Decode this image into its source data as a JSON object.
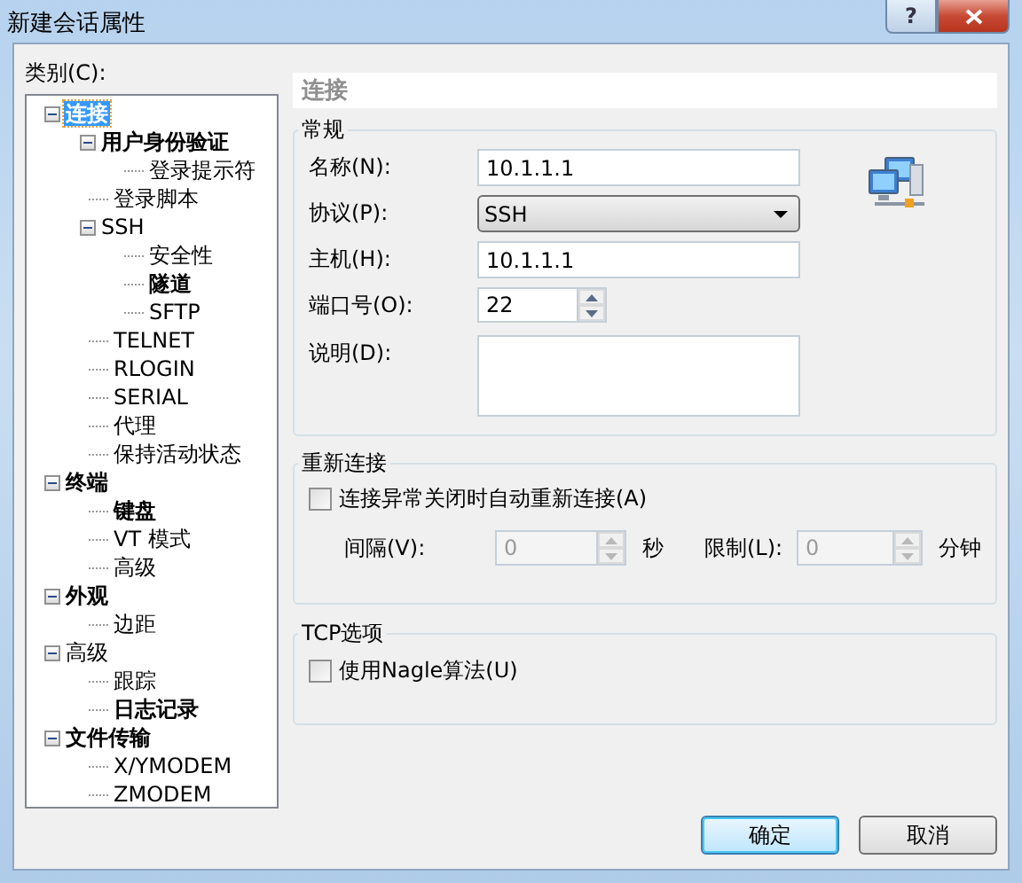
{
  "window": {
    "title": "新建会话属性",
    "help_button": "?"
  },
  "category_label": "类别(C):",
  "tree": [
    {
      "label": "连接",
      "bold": true,
      "selected": true,
      "expanded": true,
      "children": [
        {
          "label": "用户身份验证",
          "bold": true,
          "selected": false,
          "expanded": true,
          "children": [
            {
              "label": "登录提示符",
              "bold": false,
              "selected": false
            }
          ]
        },
        {
          "label": "登录脚本",
          "bold": false,
          "selected": false
        },
        {
          "label": "SSH",
          "bold": false,
          "selected": false,
          "expanded": true,
          "children": [
            {
              "label": "安全性",
              "bold": false,
              "selected": false
            },
            {
              "label": "隧道",
              "bold": true,
              "selected": false
            },
            {
              "label": "SFTP",
              "bold": false,
              "selected": false
            }
          ]
        },
        {
          "label": "TELNET",
          "bold": false,
          "selected": false
        },
        {
          "label": "RLOGIN",
          "bold": false,
          "selected": false
        },
        {
          "label": "SERIAL",
          "bold": false,
          "selected": false
        },
        {
          "label": "代理",
          "bold": false,
          "selected": false
        },
        {
          "label": "保持活动状态",
          "bold": false,
          "selected": false
        }
      ]
    },
    {
      "label": "终端",
      "bold": true,
      "selected": false,
      "expanded": true,
      "children": [
        {
          "label": "键盘",
          "bold": true,
          "selected": false
        },
        {
          "label": "VT 模式",
          "bold": false,
          "selected": false
        },
        {
          "label": "高级",
          "bold": false,
          "selected": false
        }
      ]
    },
    {
      "label": "外观",
      "bold": true,
      "selected": false,
      "expanded": true,
      "children": [
        {
          "label": "边距",
          "bold": false,
          "selected": false
        }
      ]
    },
    {
      "label": "高级",
      "bold": false,
      "selected": false,
      "expanded": true,
      "children": [
        {
          "label": "跟踪",
          "bold": false,
          "selected": false
        },
        {
          "label": "日志记录",
          "bold": true,
          "selected": false
        }
      ]
    },
    {
      "label": "文件传输",
      "bold": true,
      "selected": false,
      "expanded": true,
      "children": [
        {
          "label": "X/YMODEM",
          "bold": false,
          "selected": false
        },
        {
          "label": "ZMODEM",
          "bold": false,
          "selected": false
        }
      ]
    }
  ],
  "panel": {
    "header": "连接",
    "general": {
      "title": "常规",
      "name": {
        "label": "名称(N):",
        "value": "10.1.1.1"
      },
      "protocol": {
        "label": "协议(P):",
        "value": "SSH"
      },
      "host": {
        "label": "主机(H):",
        "value": "10.1.1.1"
      },
      "port": {
        "label": "端口号(O):",
        "value": "22"
      },
      "description": {
        "label": "说明(D):"
      }
    },
    "reconnect": {
      "title": "重新连接",
      "auto": {
        "label": "连接异常关闭时自动重新连接(A)",
        "checked": false
      },
      "interval": {
        "label": "间隔(V):",
        "value": "0",
        "disabled": true,
        "unit": "秒"
      },
      "limit": {
        "label": "限制(L):",
        "value": "0",
        "disabled": true,
        "unit": "分钟"
      }
    },
    "tcp": {
      "title": "TCP选项",
      "nagle": {
        "label": "使用Nagle算法(U)",
        "checked": false
      }
    }
  },
  "buttons": [
    {
      "label": "确定",
      "default": true
    },
    {
      "label": "取消",
      "default": false
    }
  ]
}
